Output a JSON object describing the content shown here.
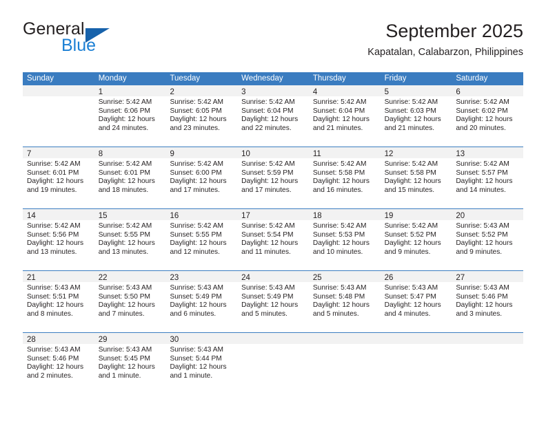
{
  "brand": {
    "word1": "General",
    "word2": "Blue",
    "triangle_icon": "triangle-logo-icon",
    "accent_color": "#1762ab",
    "blue_text_color": "#1b7fd4"
  },
  "header": {
    "title": "September 2025",
    "subtitle": "Kapatalan, Calabarzon, Philippines"
  },
  "calendar": {
    "header_bg_color": "#3a7cc0",
    "daynum_band_color": "#f2f2f2",
    "weekdays": [
      "Sunday",
      "Monday",
      "Tuesday",
      "Wednesday",
      "Thursday",
      "Friday",
      "Saturday"
    ],
    "weeks": [
      [
        {
          "day": "",
          "lines": []
        },
        {
          "day": "1",
          "lines": [
            "Sunrise: 5:42 AM",
            "Sunset: 6:06 PM",
            "Daylight: 12 hours",
            "and 24 minutes."
          ]
        },
        {
          "day": "2",
          "lines": [
            "Sunrise: 5:42 AM",
            "Sunset: 6:05 PM",
            "Daylight: 12 hours",
            "and 23 minutes."
          ]
        },
        {
          "day": "3",
          "lines": [
            "Sunrise: 5:42 AM",
            "Sunset: 6:04 PM",
            "Daylight: 12 hours",
            "and 22 minutes."
          ]
        },
        {
          "day": "4",
          "lines": [
            "Sunrise: 5:42 AM",
            "Sunset: 6:04 PM",
            "Daylight: 12 hours",
            "and 21 minutes."
          ]
        },
        {
          "day": "5",
          "lines": [
            "Sunrise: 5:42 AM",
            "Sunset: 6:03 PM",
            "Daylight: 12 hours",
            "and 21 minutes."
          ]
        },
        {
          "day": "6",
          "lines": [
            "Sunrise: 5:42 AM",
            "Sunset: 6:02 PM",
            "Daylight: 12 hours",
            "and 20 minutes."
          ]
        }
      ],
      [
        {
          "day": "7",
          "lines": [
            "Sunrise: 5:42 AM",
            "Sunset: 6:01 PM",
            "Daylight: 12 hours",
            "and 19 minutes."
          ]
        },
        {
          "day": "8",
          "lines": [
            "Sunrise: 5:42 AM",
            "Sunset: 6:01 PM",
            "Daylight: 12 hours",
            "and 18 minutes."
          ]
        },
        {
          "day": "9",
          "lines": [
            "Sunrise: 5:42 AM",
            "Sunset: 6:00 PM",
            "Daylight: 12 hours",
            "and 17 minutes."
          ]
        },
        {
          "day": "10",
          "lines": [
            "Sunrise: 5:42 AM",
            "Sunset: 5:59 PM",
            "Daylight: 12 hours",
            "and 17 minutes."
          ]
        },
        {
          "day": "11",
          "lines": [
            "Sunrise: 5:42 AM",
            "Sunset: 5:58 PM",
            "Daylight: 12 hours",
            "and 16 minutes."
          ]
        },
        {
          "day": "12",
          "lines": [
            "Sunrise: 5:42 AM",
            "Sunset: 5:58 PM",
            "Daylight: 12 hours",
            "and 15 minutes."
          ]
        },
        {
          "day": "13",
          "lines": [
            "Sunrise: 5:42 AM",
            "Sunset: 5:57 PM",
            "Daylight: 12 hours",
            "and 14 minutes."
          ]
        }
      ],
      [
        {
          "day": "14",
          "lines": [
            "Sunrise: 5:42 AM",
            "Sunset: 5:56 PM",
            "Daylight: 12 hours",
            "and 13 minutes."
          ]
        },
        {
          "day": "15",
          "lines": [
            "Sunrise: 5:42 AM",
            "Sunset: 5:55 PM",
            "Daylight: 12 hours",
            "and 13 minutes."
          ]
        },
        {
          "day": "16",
          "lines": [
            "Sunrise: 5:42 AM",
            "Sunset: 5:55 PM",
            "Daylight: 12 hours",
            "and 12 minutes."
          ]
        },
        {
          "day": "17",
          "lines": [
            "Sunrise: 5:42 AM",
            "Sunset: 5:54 PM",
            "Daylight: 12 hours",
            "and 11 minutes."
          ]
        },
        {
          "day": "18",
          "lines": [
            "Sunrise: 5:42 AM",
            "Sunset: 5:53 PM",
            "Daylight: 12 hours",
            "and 10 minutes."
          ]
        },
        {
          "day": "19",
          "lines": [
            "Sunrise: 5:42 AM",
            "Sunset: 5:52 PM",
            "Daylight: 12 hours",
            "and 9 minutes."
          ]
        },
        {
          "day": "20",
          "lines": [
            "Sunrise: 5:43 AM",
            "Sunset: 5:52 PM",
            "Daylight: 12 hours",
            "and 9 minutes."
          ]
        }
      ],
      [
        {
          "day": "21",
          "lines": [
            "Sunrise: 5:43 AM",
            "Sunset: 5:51 PM",
            "Daylight: 12 hours",
            "and 8 minutes."
          ]
        },
        {
          "day": "22",
          "lines": [
            "Sunrise: 5:43 AM",
            "Sunset: 5:50 PM",
            "Daylight: 12 hours",
            "and 7 minutes."
          ]
        },
        {
          "day": "23",
          "lines": [
            "Sunrise: 5:43 AM",
            "Sunset: 5:49 PM",
            "Daylight: 12 hours",
            "and 6 minutes."
          ]
        },
        {
          "day": "24",
          "lines": [
            "Sunrise: 5:43 AM",
            "Sunset: 5:49 PM",
            "Daylight: 12 hours",
            "and 5 minutes."
          ]
        },
        {
          "day": "25",
          "lines": [
            "Sunrise: 5:43 AM",
            "Sunset: 5:48 PM",
            "Daylight: 12 hours",
            "and 5 minutes."
          ]
        },
        {
          "day": "26",
          "lines": [
            "Sunrise: 5:43 AM",
            "Sunset: 5:47 PM",
            "Daylight: 12 hours",
            "and 4 minutes."
          ]
        },
        {
          "day": "27",
          "lines": [
            "Sunrise: 5:43 AM",
            "Sunset: 5:46 PM",
            "Daylight: 12 hours",
            "and 3 minutes."
          ]
        }
      ],
      [
        {
          "day": "28",
          "lines": [
            "Sunrise: 5:43 AM",
            "Sunset: 5:46 PM",
            "Daylight: 12 hours",
            "and 2 minutes."
          ]
        },
        {
          "day": "29",
          "lines": [
            "Sunrise: 5:43 AM",
            "Sunset: 5:45 PM",
            "Daylight: 12 hours",
            "and 1 minute."
          ]
        },
        {
          "day": "30",
          "lines": [
            "Sunrise: 5:43 AM",
            "Sunset: 5:44 PM",
            "Daylight: 12 hours",
            "and 1 minute."
          ]
        },
        {
          "day": "",
          "lines": []
        },
        {
          "day": "",
          "lines": []
        },
        {
          "day": "",
          "lines": []
        },
        {
          "day": "",
          "lines": []
        }
      ]
    ]
  }
}
